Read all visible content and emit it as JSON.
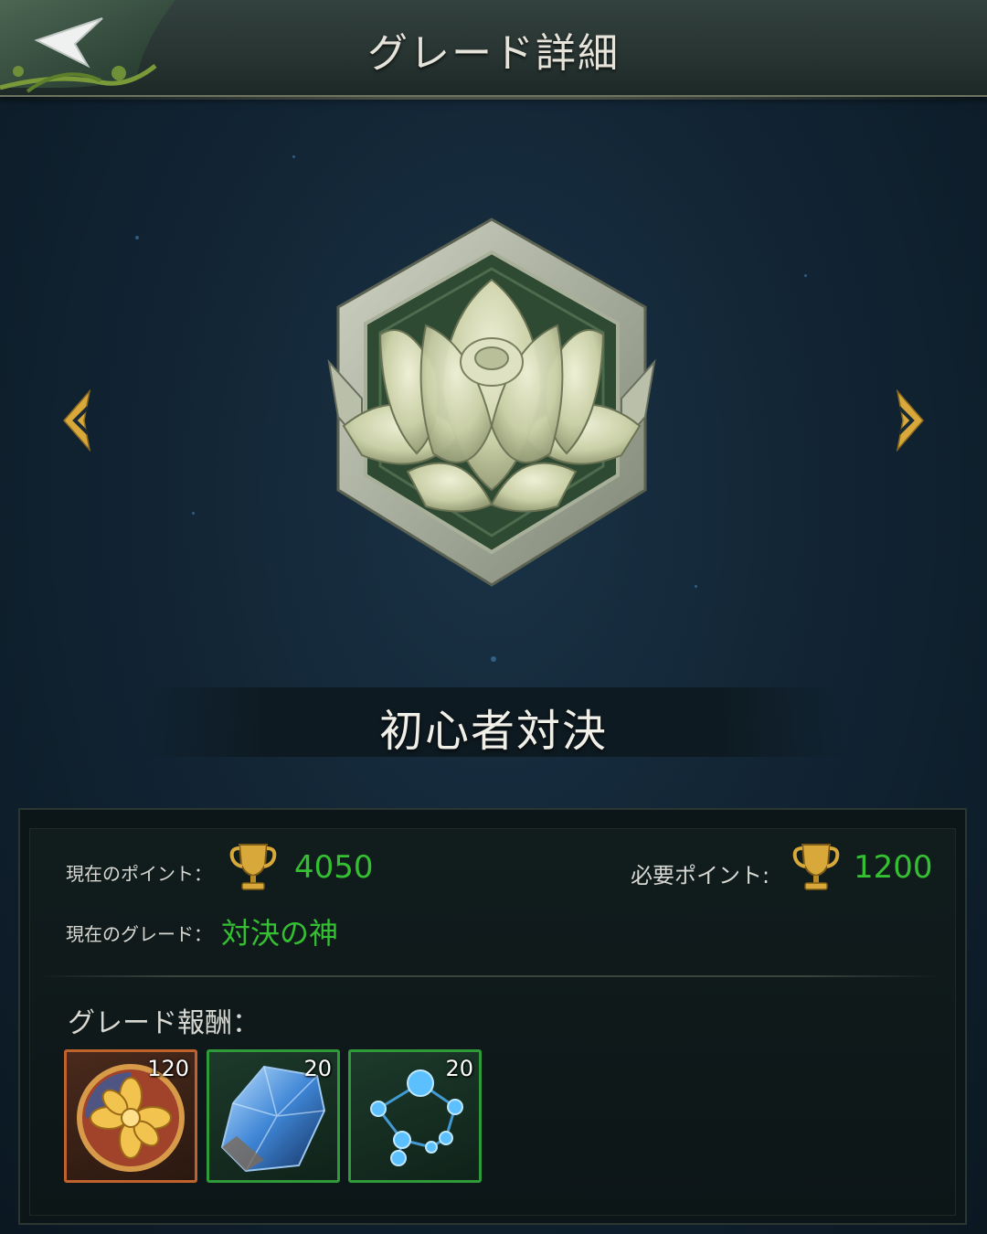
{
  "header": {
    "title": "グレード詳細"
  },
  "grade": {
    "name": "初心者対決"
  },
  "info": {
    "current_points_label": "現在のポイント：",
    "current_points_value": "4050",
    "required_points_label": "必要ポイント:",
    "required_points_value": "1200",
    "current_grade_label": "現在のグレード：",
    "current_grade_value": "対決の神"
  },
  "rewards": {
    "label": "グレード報酬：",
    "items": [
      {
        "icon": "gold-flower-medal-icon",
        "count": "120",
        "frame": "orange"
      },
      {
        "icon": "blue-crystal-icon",
        "count": "20",
        "frame": "green"
      },
      {
        "icon": "constellation-orbs-icon",
        "count": "20",
        "frame": "green"
      }
    ]
  },
  "colors": {
    "accent_green": "#35c033",
    "gold": "#d8a93a",
    "frame_orange": "#c0622b",
    "frame_green": "#2f9a3a"
  }
}
